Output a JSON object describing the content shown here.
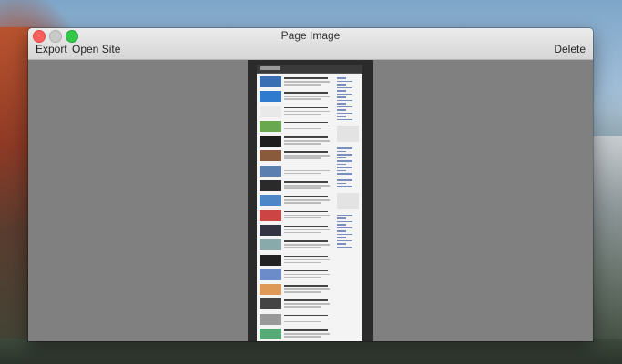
{
  "window": {
    "title": "Page Image"
  },
  "toolbar": {
    "export_label": "Export",
    "open_site_label": "Open Site",
    "delete_label": "Delete"
  },
  "preview": {
    "thumb_colors": [
      "#3a6fb3",
      "#2f7bd0",
      "#e9e9e9",
      "#6aa84f",
      "#1d1d1d",
      "#8a5a3c",
      "#5b7fae",
      "#2a2a2a",
      "#4d87c7",
      "#c44",
      "#334",
      "#8aa",
      "#222",
      "#6b8cc9",
      "#d95",
      "#444",
      "#999",
      "#5a7",
      "#2c4d7a",
      "#aaa"
    ]
  }
}
